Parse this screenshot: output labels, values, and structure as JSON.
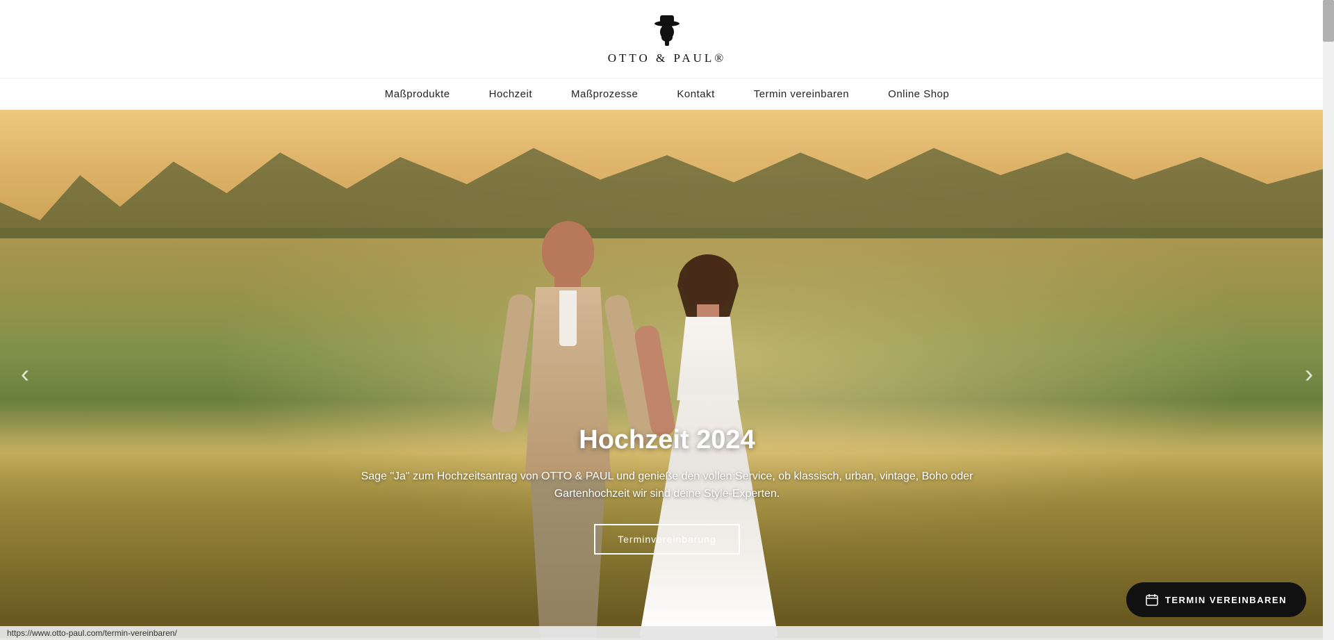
{
  "header": {
    "logo_text": "OTTO & PAUL®",
    "nav_items": [
      {
        "label": "Maßprodukte",
        "href": "#"
      },
      {
        "label": "Hochzeit",
        "href": "#"
      },
      {
        "label": "Maßprozesse",
        "href": "#"
      },
      {
        "label": "Kontakt",
        "href": "#"
      },
      {
        "label": "Termin vereinbaren",
        "href": "#"
      },
      {
        "label": "Online Shop",
        "href": "#"
      }
    ]
  },
  "hero": {
    "title": "Hochzeit 2024",
    "subtitle": "Sage \"Ja\" zum Hochzeitsantrag von OTTO & PAUL und genieße den vollen Service, ob klassisch, urban, vintage, Boho oder\nGartenhochzeit wir sind deine Style-Experten.",
    "cta_button": "Terminvereinbarung",
    "fab_button": "TERMIN VEREINBAREN",
    "arrow_left": "‹",
    "arrow_right": "›"
  },
  "statusbar": {
    "url": "https://www.otto-paul.com/termin-vereinbaren/"
  },
  "colors": {
    "nav_link": "#222",
    "logo": "#111",
    "hero_text": "#ffffff",
    "fab_bg": "#111111",
    "fab_text": "#ffffff"
  }
}
